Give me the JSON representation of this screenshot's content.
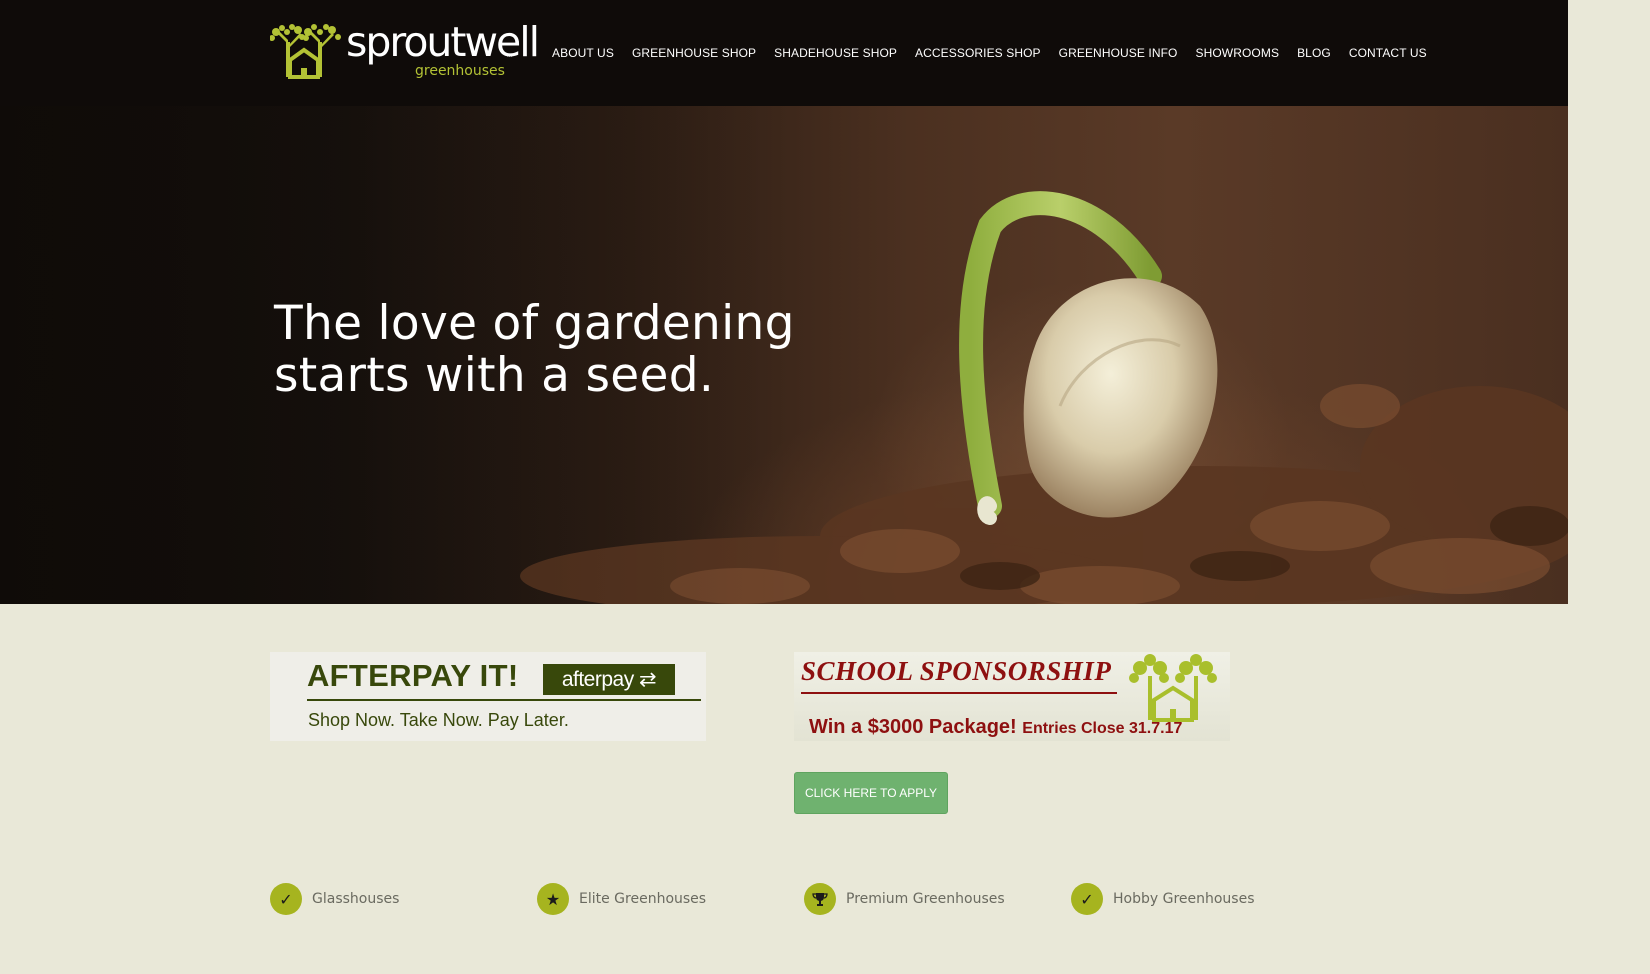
{
  "brand": {
    "name": "sproutwell",
    "sub": "greenhouses",
    "tm": "™",
    "accent": "#b3c235"
  },
  "nav": {
    "items": [
      {
        "label": "ABOUT US"
      },
      {
        "label": "GREENHOUSE SHOP"
      },
      {
        "label": "SHADEHOUSE SHOP"
      },
      {
        "label": "ACCESSORIES SHOP"
      },
      {
        "label": "GREENHOUSE INFO"
      },
      {
        "label": "SHOWROOMS"
      },
      {
        "label": "BLOG"
      },
      {
        "label": "CONTACT US"
      }
    ]
  },
  "hero": {
    "line1": "The love of gardening",
    "line2": "starts with a seed."
  },
  "afterpay_banner": {
    "title": "AFTERPAY IT!",
    "logo_text": "afterpay",
    "subtitle": "Shop Now. Take Now. Pay Later."
  },
  "school_banner": {
    "title": "SCHOOL SPONSORSHIP",
    "win": "Win a $3000 Package!",
    "close": "Entries Close 31.7.17"
  },
  "apply_button": {
    "label": "CLICK HERE TO APPLY"
  },
  "features": [
    {
      "icon": "check-icon",
      "label": "Glasshouses"
    },
    {
      "icon": "star-icon",
      "label": "Elite Greenhouses"
    },
    {
      "icon": "trophy-icon",
      "label": "Premium Greenhouses"
    },
    {
      "icon": "check-icon",
      "label": "Hobby Greenhouses"
    }
  ],
  "colors": {
    "header_bg": "#0f0b09",
    "page_bg": "#e9e8d8",
    "feature_icon_bg": "#a6b41f",
    "button_bg": "#6fb26f",
    "afterpay_green": "#38480b",
    "school_red": "#8e1010"
  }
}
